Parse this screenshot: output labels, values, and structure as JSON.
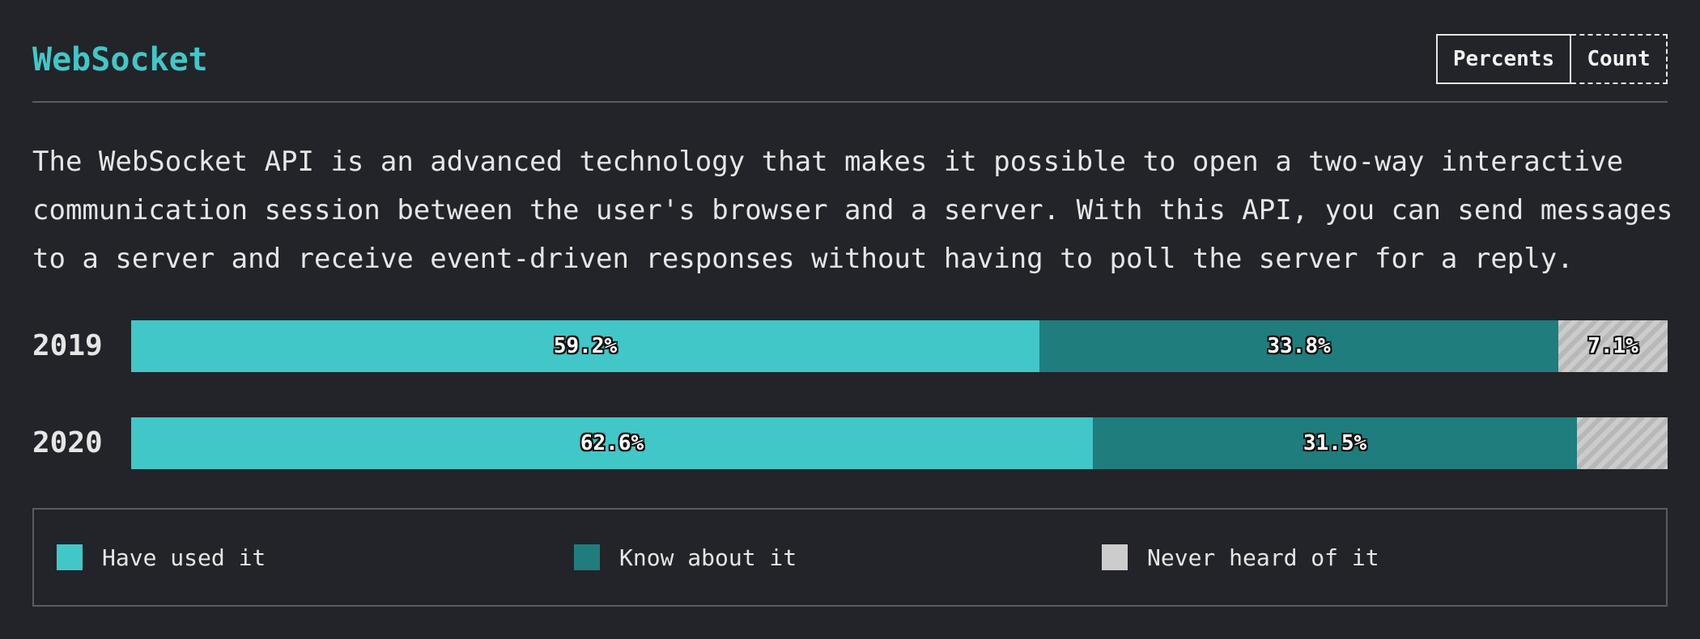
{
  "title": "WebSocket",
  "toggle": {
    "percents_label": "Percents",
    "count_label": "Count"
  },
  "description_lines": [
    "The WebSocket API is an advanced technology that makes it possible to open a two-way interactive",
    "communication session between the user's browser and a server. With this API, you can send messages",
    "to a server and receive event-driven responses without having to poll the server for a reply."
  ],
  "colors": {
    "accent": "#41c7c7",
    "have_used": "#41c7c7",
    "know_about": "#1f7d7d",
    "never_heard": "#cccccc",
    "background": "#232429"
  },
  "chart_data": {
    "type": "bar",
    "orientation": "horizontal",
    "stacked": true,
    "normalized": true,
    "categories": [
      "2019",
      "2020"
    ],
    "series": [
      {
        "name": "Have used it",
        "values": [
          59.2,
          62.6
        ],
        "labels": [
          "59.2%",
          "62.6%"
        ],
        "color": "#41c7c7"
      },
      {
        "name": "Know about it",
        "values": [
          33.8,
          31.5
        ],
        "labels": [
          "33.8%",
          "31.5%"
        ],
        "color": "#1f7d7d"
      },
      {
        "name": "Never heard of it",
        "values": [
          7.1,
          5.9
        ],
        "labels": [
          "7.1%",
          ""
        ],
        "color": "#cccccc",
        "pattern": "diagonal-hatch"
      }
    ],
    "legend_placement": "bottom"
  },
  "legend": [
    {
      "label": "Have used it",
      "color": "#41c7c7"
    },
    {
      "label": "Know about it",
      "color": "#1f7d7d"
    },
    {
      "label": "Never heard of it",
      "color": "#cccccc"
    }
  ]
}
